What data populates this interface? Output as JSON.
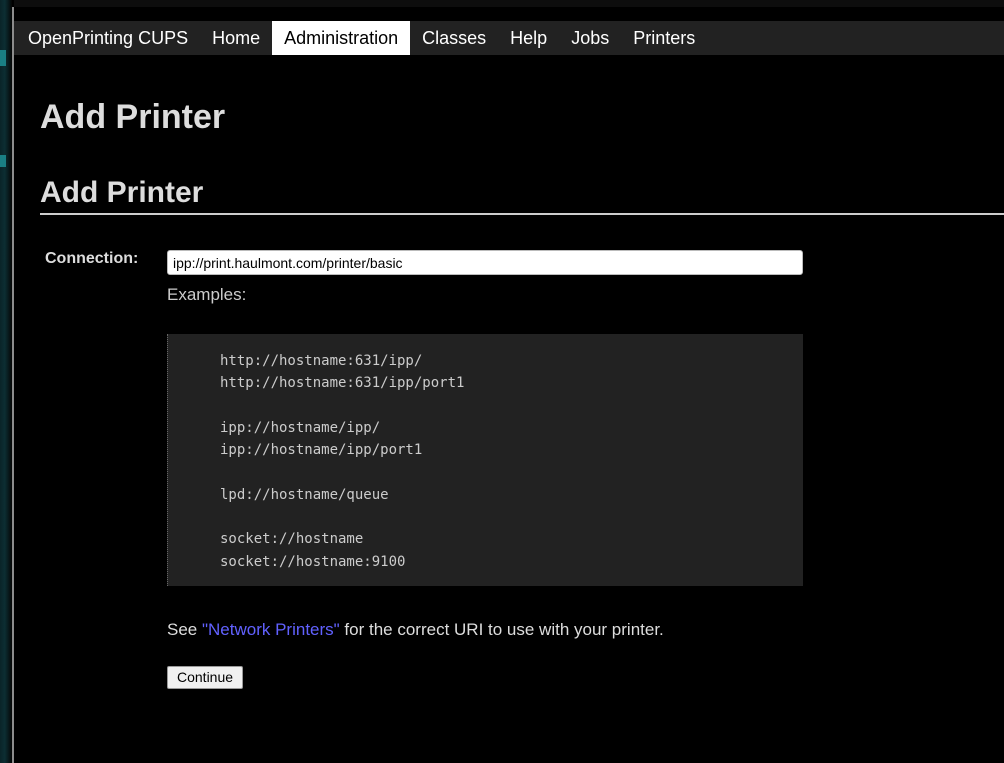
{
  "nav": {
    "brand": "OpenPrinting CUPS",
    "items": [
      {
        "label": "Home",
        "active": false
      },
      {
        "label": "Administration",
        "active": true
      },
      {
        "label": "Classes",
        "active": false
      },
      {
        "label": "Help",
        "active": false
      },
      {
        "label": "Jobs",
        "active": false
      },
      {
        "label": "Printers",
        "active": false
      }
    ]
  },
  "page": {
    "title": "Add Printer",
    "section_title": "Add Printer"
  },
  "form": {
    "connection_label": "Connection:",
    "connection_value": "ipp://print.haulmont.com/printer/basic",
    "examples_label": "Examples:",
    "examples": [
      "http://hostname:631/ipp/",
      "http://hostname:631/ipp/port1",
      "",
      "ipp://hostname/ipp/",
      "ipp://hostname/ipp/port1",
      "",
      "lpd://hostname/queue",
      "",
      "socket://hostname",
      "socket://hostname:9100"
    ],
    "see_prefix": "See ",
    "see_link": "\"Network Printers\"",
    "see_suffix": " for the correct URI to use with your printer.",
    "continue_label": "Continue"
  },
  "colors": {
    "background": "#000000",
    "navbar": "#222222",
    "link": "#6161ff",
    "examples_bg": "#222222"
  }
}
